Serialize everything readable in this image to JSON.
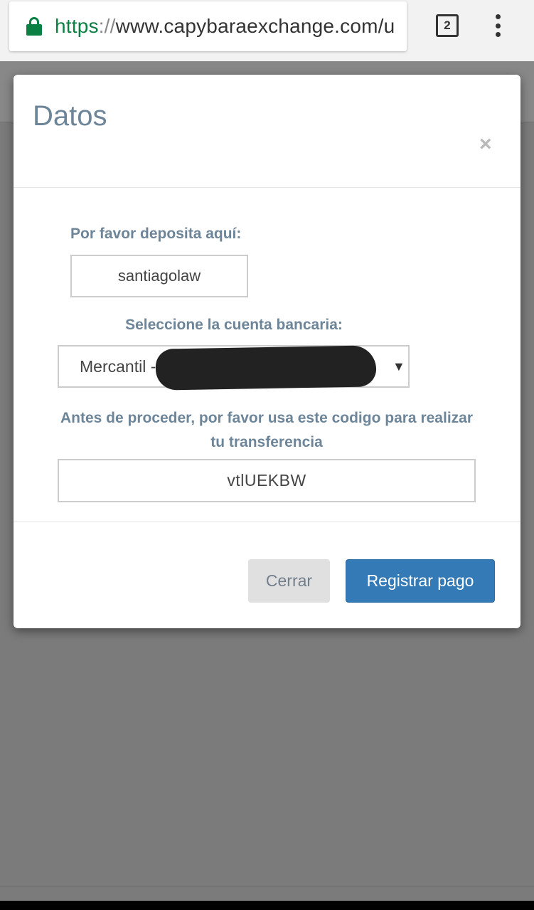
{
  "browser": {
    "url_scheme": "https",
    "url_separator": "://",
    "url_rest": "www.capybaraexchange.com/u",
    "tab_count": "2"
  },
  "modal": {
    "title": "Datos",
    "close_symbol": "×",
    "deposit_label": "Por favor deposita aquí:",
    "deposit_value": "santiagolaw",
    "bank_label": "Seleccione la cuenta bancaria:",
    "bank_selected": "Mercantil --",
    "code_label": "Antes de proceder, por favor usa este codigo para realizar tu transferencia",
    "code_value": "vtlUEKBW",
    "close_button": "Cerrar",
    "submit_button": "Registrar pago"
  },
  "colors": {
    "accent": "#337ab7",
    "label": "#6d8599",
    "secure": "#0b8043"
  }
}
